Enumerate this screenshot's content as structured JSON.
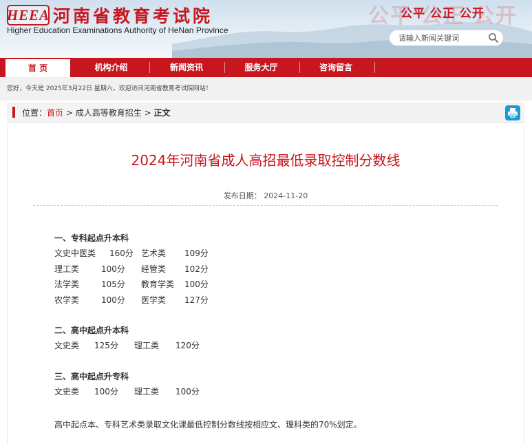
{
  "header": {
    "logo_mark": "HEEA",
    "site_name_cn": "河南省教育考试院",
    "site_name_en": "Higher Education Examinations Authority of HeNan Province",
    "slogan": "公平 公正 公开",
    "search_placeholder": "请输入新闻关键词"
  },
  "nav": {
    "items": [
      {
        "label": "首 页"
      },
      {
        "label": "机构介绍"
      },
      {
        "label": "新闻资讯"
      },
      {
        "label": "服务大厅"
      },
      {
        "label": "咨询留言"
      }
    ]
  },
  "welcome_text": "您好，今天是 2025年3月22日 星期六，欢迎访问河南省教育考试院网站！",
  "breadcrumb": {
    "prefix": "位置：",
    "home": "首页",
    "sep1": ">",
    "section": "成人高等教育招生",
    "sep2": ">",
    "current": "正文"
  },
  "article": {
    "title": "2024年河南省成人高招最低录取控制分数线",
    "publish_label": "发布日期：",
    "publish_date": "2024-11-20",
    "sections": [
      {
        "heading": "一、专科起点升本科",
        "rows": [
          {
            "c1": "文史中医类",
            "v1": "160分",
            "c2": "艺术类",
            "v2": "109分"
          },
          {
            "c1": "理工类",
            "v1": "100分",
            "c2": "经管类",
            "v2": "102分"
          },
          {
            "c1": "法学类",
            "v1": "105分",
            "c2": "教育学类",
            "v2": "100分"
          },
          {
            "c1": "农学类",
            "v1": "100分",
            "c2": "医学类",
            "v2": "127分"
          }
        ]
      },
      {
        "heading": "二、高中起点升本科",
        "rows": [
          {
            "c1": "文史类",
            "v1": "125分",
            "c2": "理工类",
            "v2": "120分"
          }
        ]
      },
      {
        "heading": "三、高中起点升专科",
        "rows": [
          {
            "c1": "文史类",
            "v1": "100分",
            "c2": "理工类",
            "v2": "100分"
          }
        ]
      }
    ],
    "note": "高中起点本、专科艺术类录取文化课最低控制分数线按相应文、理科类的70%划定。"
  },
  "colors": {
    "brand_red": "#c8161e",
    "print_blue": "#1d9ad6"
  },
  "icons": {
    "search": "search-icon",
    "print": "print-icon"
  }
}
